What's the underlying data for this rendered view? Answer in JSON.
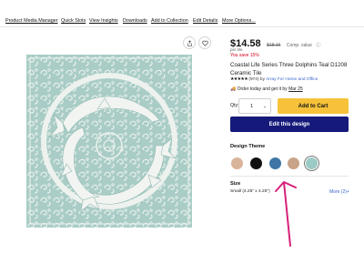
{
  "nav": {
    "items": [
      "Product Media Manager",
      "Quick Slots",
      "View Insights",
      "Downloads",
      "Add to Collection",
      "Edit Details",
      "More Options..."
    ]
  },
  "product": {
    "price": "$14.58",
    "old_price": "$18.16",
    "comp_label": "Comp. value",
    "per_tile": "per tile",
    "savings": "You save 15%",
    "title": "Coastal Life Series Three Dolphins Teal D1208 Ceramic Tile",
    "stars": "★★★★★",
    "review_count": "(974)",
    "by_text": "by",
    "seller": "Array For Home and Office",
    "delivery_prefix": "Order today and get it by",
    "delivery_date": "Mar 25",
    "qty_label": "Qty:",
    "qty_value": "1",
    "add_to_cart": "Add to Cart",
    "edit_design": "Edit this design"
  },
  "design_theme": {
    "label": "Design Theme",
    "swatches": [
      {
        "name": "peach",
        "color": "#d9b39a"
      },
      {
        "name": "black",
        "color": "#111111"
      },
      {
        "name": "blue",
        "color": "#3d75a6"
      },
      {
        "name": "tan",
        "color": "#c9a387"
      },
      {
        "name": "seafoam",
        "color": "#9ccac4"
      }
    ]
  },
  "size": {
    "label": "Size",
    "value": "Small (4.25\" x 4.25\")",
    "more": "More (2)+"
  },
  "colors": {
    "tile_bg": "#a9cdc6",
    "tile_fg": "#f2f4f1",
    "cart": "#f7c23a",
    "edit": "#14197a",
    "annotation": "#d6207a"
  },
  "icons": {
    "share": "share-icon",
    "favorite": "heart-icon",
    "truck": "truck-icon",
    "info": "info-icon"
  }
}
